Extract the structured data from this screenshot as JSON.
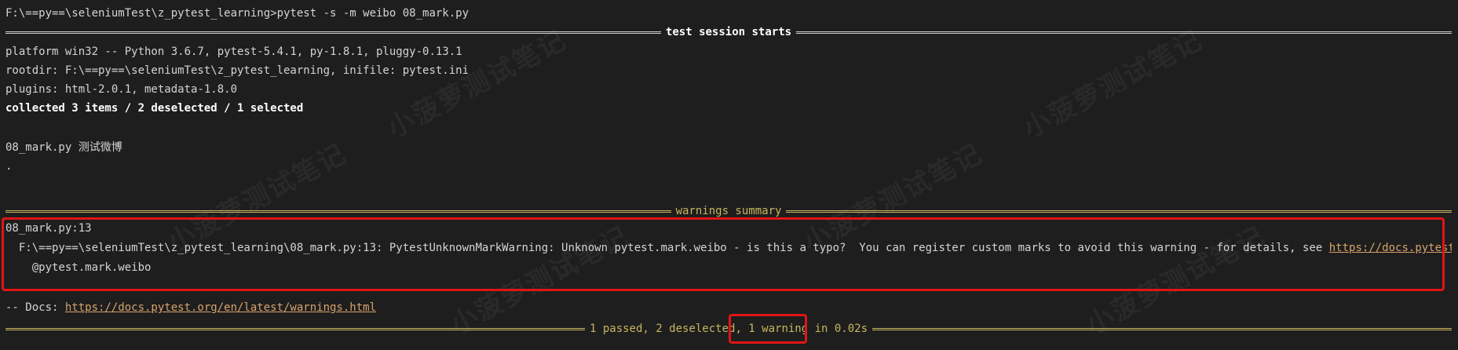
{
  "terminal": {
    "prompt_line": "F:\\==py==\\seleniumTest\\z_pytest_learning>pytest -s -m weibo 08_mark.py",
    "session_header": "test session starts",
    "platform_line": "platform win32 -- Python 3.6.7, pytest-5.4.1, py-1.8.1, pluggy-0.13.1",
    "rootdir_line": "rootdir: F:\\==py==\\seleniumTest\\z_pytest_learning, inifile: pytest.ini",
    "plugins_line": "plugins: html-2.0.1, metadata-1.8.0",
    "collected_line": "collected 3 items / 2 deselected / 1 selected",
    "test_file_line": "08_mark.py 测试微博",
    "dot_line": ".",
    "warnings_header": "warnings summary",
    "warning_location": "08_mark.py:13",
    "warning_message": "  F:\\==py==\\seleniumTest\\z_pytest_learning\\08_mark.py:13: PytestUnknownMarkWarning: Unknown pytest.mark.weibo - is this a typo?  You can register custom marks to avoid this warning - for details, see ",
    "warning_link": "https://docs.pytest.org/en/latest/mark.html",
    "warning_code": "    @pytest.mark.weibo",
    "docs_prefix": "-- Docs: ",
    "docs_link": "https://docs.pytest.org/en/latest/warnings.html",
    "final_passed": "1 passed",
    "final_sep": ", ",
    "final_deselected": "2 deselected",
    "final_warning": "1 warning in 0.02s"
  },
  "watermark": {
    "text": "小菠萝测试笔记"
  },
  "colors": {
    "background": "#1e1e1e",
    "text": "#d4d4d4",
    "summary_yellow": "#c8b560",
    "link_orange": "#d7a36b",
    "highlight_red": "#e01515"
  }
}
